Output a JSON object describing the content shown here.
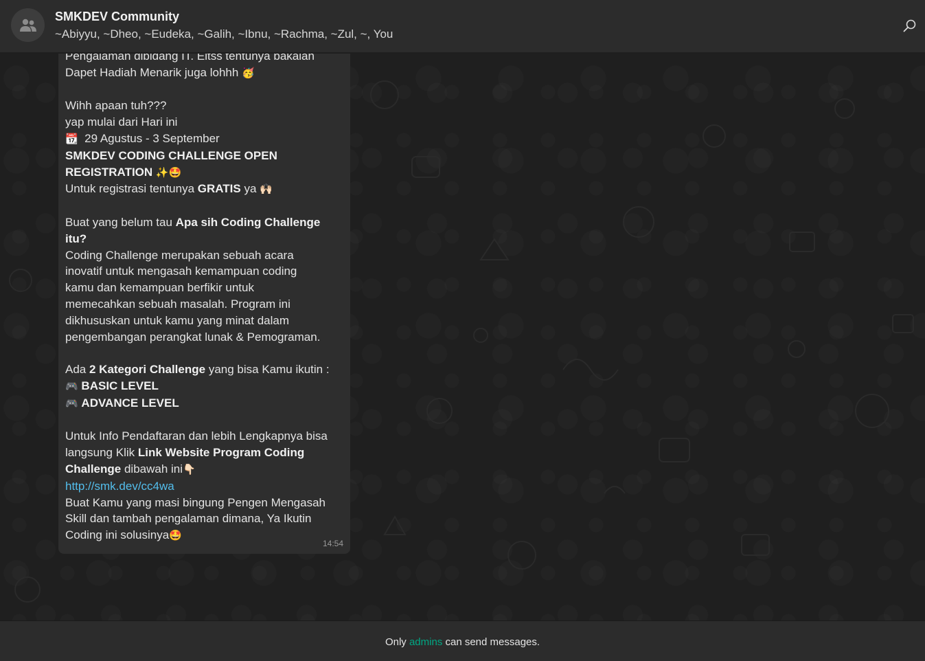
{
  "header": {
    "title": "SMKDEV Community",
    "members": "~Abiyyu, ~Dheo, ~Eudeka, ~Galih, ~Ibnu, ~Rachma, ~Zul, ~, You",
    "avatar_icon": "group-icon",
    "search_icon": "search-icon"
  },
  "message": {
    "line1": "Pengalaman dibidang IT. Eitss tentunya bakalan",
    "line2": "Dapet Hadiah Menarik juga lohhh",
    "line2_emoji": "🥳",
    "line4": "Wihh apaan tuh???",
    "line5": "yap mulai dari Hari ini",
    "date_emoji": "📆",
    "line6": "29 Agustus - 3 September",
    "line7": "SMKDEV CODING CHALLENGE OPEN",
    "line8": "REGISTRATION",
    "line8_emoji": "✨🤩",
    "line9_pre": "Untuk registrasi tentunya ",
    "line9_bold": "GRATIS",
    "line9_post": " ya",
    "line9_emoji": "🙌🏻",
    "line11_pre": "Buat yang belum tau ",
    "line11_bold": "Apa sih Coding Challenge",
    "line12_bold": "itu?",
    "line13": "Coding Challenge merupakan sebuah acara",
    "line14": "inovatif untuk mengasah kemampuan coding",
    "line15": "kamu dan kemampuan berfikir untuk",
    "line16": "memecahkan sebuah masalah. Program ini",
    "line17": "dikhususkan untuk kamu yang minat dalam",
    "line18": "pengembangan perangkat lunak & Pemograman.",
    "line20_pre": "Ada ",
    "line20_bold": "2 Kategori Challenge",
    "line20_post": " yang bisa Kamu ikutin :",
    "game_emoji": "🎮",
    "line21": "BASIC LEVEL",
    "line22": "ADVANCE LEVEL",
    "line24": "Untuk Info Pendaftaran dan lebih Lengkapnya bisa",
    "line25_pre": "langsung Klik ",
    "line25_bold": "Link Website Program Coding",
    "line26_bold": "Challenge",
    "line26_post": " dibawah ini",
    "line26_emoji": "👇🏻",
    "link": "http://smk.dev/cc4wa",
    "line28": "Buat Kamu yang masi bingung Pengen Mengasah",
    "line29": "Skill dan tambah pengalaman dimana, Ya Ikutin",
    "line30": "Coding ini solusinya",
    "line30_emoji": "🤩",
    "time": "14:54"
  },
  "footer": {
    "pre": "Only ",
    "admins": "admins",
    "post": " can send messages."
  },
  "colors": {
    "accent": "#00a884",
    "link": "#53bdeb",
    "bubble": "#2e2e2e",
    "header": "#2c2c2c"
  }
}
